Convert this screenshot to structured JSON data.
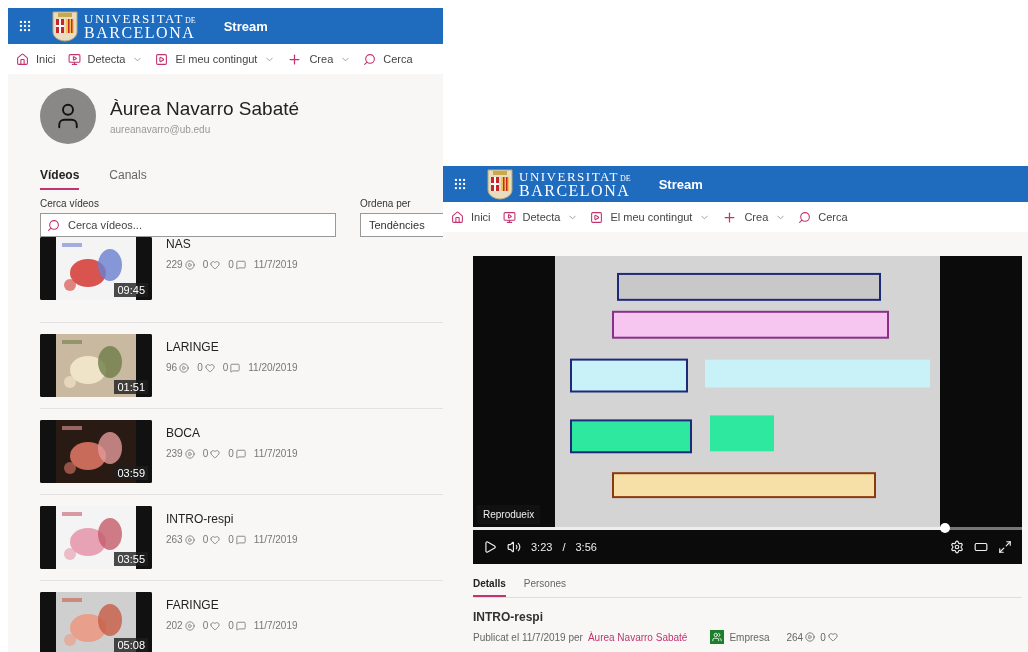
{
  "library_window": {
    "header": {
      "brand_line_1": "UNIVERSITAT",
      "brand_de": "DE",
      "brand_line_2": "BARCELONA",
      "app_name": "Stream"
    },
    "nav": [
      {
        "kind": "home",
        "label": "Inici",
        "dropdown": false
      },
      {
        "kind": "discover",
        "label": "Detecta",
        "dropdown": true
      },
      {
        "kind": "content",
        "label": "El meu contingut",
        "dropdown": true
      },
      {
        "kind": "create",
        "label": "Crea",
        "dropdown": true
      },
      {
        "kind": "search",
        "label": "Cerca",
        "dropdown": false
      }
    ],
    "profile": {
      "name": "Àurea Navarro Sabaté",
      "email": "aureanavarro@ub.edu"
    },
    "tabs": [
      {
        "label": "Vídeos",
        "selected": true
      },
      {
        "label": "Canals",
        "selected": false
      }
    ],
    "search": {
      "label": "Cerca vídeos",
      "placeholder": "Cerca vídeos..."
    },
    "sort": {
      "label": "Ordena per",
      "value": "Tendències"
    },
    "videos": [
      {
        "title": "NAS",
        "views": "229",
        "likes": "0",
        "comments": "0",
        "date": "11/7/2019",
        "duration": "09:45"
      },
      {
        "title": "LARINGE",
        "views": "96",
        "likes": "0",
        "comments": "0",
        "date": "11/20/2019",
        "duration": "01:51"
      },
      {
        "title": "BOCA",
        "views": "239",
        "likes": "0",
        "comments": "0",
        "date": "11/7/2019",
        "duration": "03:59"
      },
      {
        "title": "INTRO-respi",
        "views": "263",
        "likes": "0",
        "comments": "0",
        "date": "11/7/2019",
        "duration": "03:55"
      },
      {
        "title": "FARINGE",
        "views": "202",
        "likes": "0",
        "comments": "0",
        "date": "11/7/2019",
        "duration": "05:08"
      }
    ]
  },
  "player_window": {
    "header": {
      "brand_line_1": "UNIVERSITAT",
      "brand_de": "DE",
      "brand_line_2": "BARCELONA",
      "app_name": "Stream"
    },
    "nav": [
      {
        "kind": "home",
        "label": "Inici",
        "dropdown": false
      },
      {
        "kind": "discover",
        "label": "Detecta",
        "dropdown": true
      },
      {
        "kind": "content",
        "label": "El meu contingut",
        "dropdown": true
      },
      {
        "kind": "create",
        "label": "Crea",
        "dropdown": true
      },
      {
        "kind": "search",
        "label": "Cerca",
        "dropdown": false
      }
    ],
    "player": {
      "kind": "picture",
      "tooltip": "Reprodueix",
      "level": 0.86,
      "current_time": "3:23",
      "separator": "/",
      "total_time": "3:56"
    },
    "tabs": [
      {
        "label": "Detalls",
        "selected": true
      },
      {
        "label": "Persones",
        "selected": false
      }
    ],
    "details": {
      "title": "INTRO-respi",
      "published": "Publicat el 11/7/2019 per",
      "author": "Àurea Navarro Sabaté",
      "visibility": "Empresa",
      "views": "264",
      "likes": "0"
    }
  }
}
